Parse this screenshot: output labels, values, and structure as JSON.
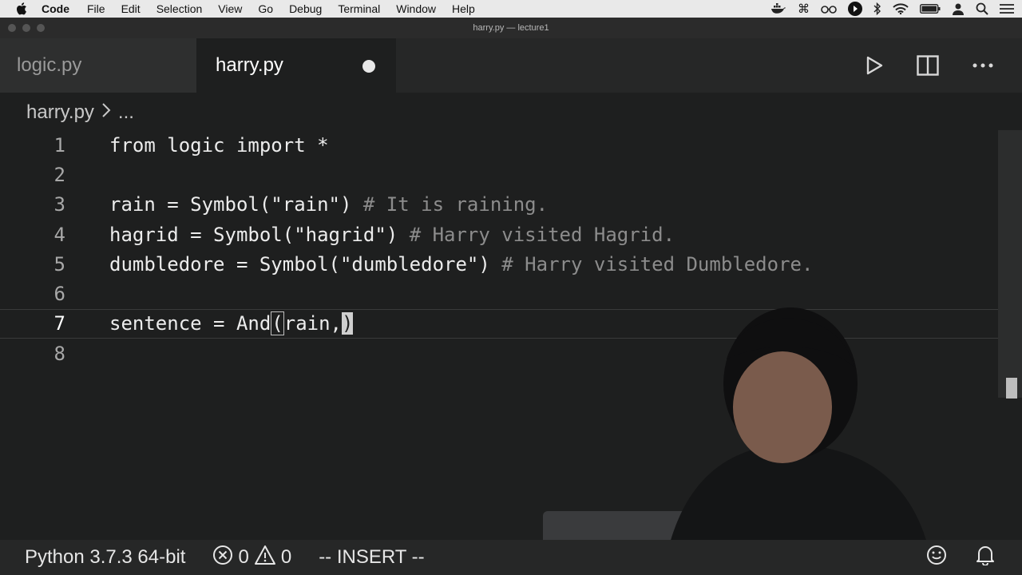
{
  "menubar": {
    "app_name": "Code",
    "items": [
      "File",
      "Edit",
      "Selection",
      "View",
      "Go",
      "Debug",
      "Terminal",
      "Window",
      "Help"
    ],
    "status_icons": [
      "docker-icon",
      "command-icon",
      "glasses-icon",
      "play-circle-icon",
      "bluetooth-icon",
      "wifi-icon",
      "battery-icon",
      "user-icon",
      "search-icon"
    ]
  },
  "window": {
    "title": "harry.py — lecture1"
  },
  "tabs": [
    {
      "label": "logic.py",
      "active": false
    },
    {
      "label": "harry.py",
      "active": true,
      "dirty": true
    }
  ],
  "breadcrumb": {
    "file": "harry.py",
    "separator": ">",
    "rest": "..."
  },
  "editor": {
    "lines": [
      {
        "num": "1",
        "code": "from logic import *",
        "comment": ""
      },
      {
        "num": "2",
        "code": "",
        "comment": ""
      },
      {
        "num": "3",
        "code": "rain = Symbol(\"rain\") ",
        "comment": "# It is raining."
      },
      {
        "num": "4",
        "code": "hagrid = Symbol(\"hagrid\") ",
        "comment": "# Harry visited Hagrid."
      },
      {
        "num": "5",
        "code": "dumbledore = Symbol(\"dumbledore\") ",
        "comment": "# Harry visited Dumbledore."
      },
      {
        "num": "6",
        "code": "",
        "comment": ""
      },
      {
        "num": "7",
        "code_before": "sentence = And",
        "paren_open": "(",
        "code_mid": "rain,",
        "cursor_char": ")"
      },
      {
        "num": "8",
        "code": "",
        "comment": ""
      }
    ]
  },
  "statusbar": {
    "python": "Python 3.7.3 64-bit",
    "errors": "0",
    "warnings": "0",
    "mode": "-- INSERT --"
  },
  "colors": {
    "background": "#1e1f1f",
    "tab_inactive": "#2e2f2f",
    "statusbar": "#262727",
    "menubar": "#e9e9e9"
  }
}
